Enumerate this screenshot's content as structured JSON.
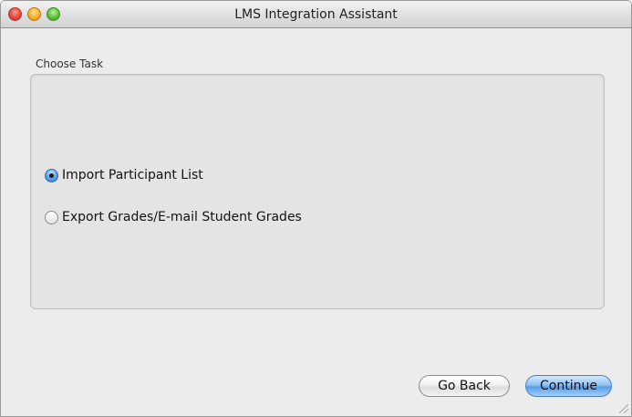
{
  "window": {
    "title": "LMS Integration Assistant"
  },
  "traffic_lights": {
    "close": "close-button",
    "minimize": "minimize-button",
    "zoom": "zoom-button"
  },
  "choose_task": {
    "label": "Choose Task",
    "options": [
      {
        "label": "Import Participant List",
        "selected": true
      },
      {
        "label": "Export Grades/E-mail Student Grades",
        "selected": false
      }
    ]
  },
  "buttons": {
    "back_label": "Go Back",
    "continue_label": "Continue"
  },
  "colors": {
    "accent": "#5a9de6",
    "window_background": "#ececec"
  }
}
